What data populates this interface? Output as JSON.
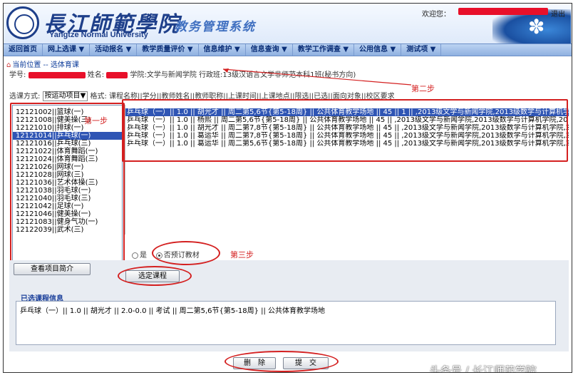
{
  "header": {
    "logo_cn": "長江師範學院",
    "logo_en": "Yangtze Normal University",
    "system_title": "教务管理系统",
    "welcome": "欢迎您：",
    "logout": "退出"
  },
  "nav": {
    "items": [
      {
        "label": "返回首页"
      },
      {
        "label": "网上选课 ▼"
      },
      {
        "label": "活动报名 ▼"
      },
      {
        "label": "教学质量评价 ▼"
      },
      {
        "label": "信息维护 ▼"
      },
      {
        "label": "信息查询 ▼"
      },
      {
        "label": "教学工作调查 ▼"
      },
      {
        "label": "公用信息 ▼"
      },
      {
        "label": "测试项 ▼"
      }
    ]
  },
  "breadcrumb": {
    "text": "当前位置 -- 选体育课"
  },
  "student_info": {
    "student_no_label": "学号:",
    "name_label": "姓名:",
    "college": "学院:文学与新闻学院",
    "class": "行政班:13级汉语言文学非师范本科1班(秘书方向)"
  },
  "selection": {
    "mode_label": "选课方式:",
    "mode_value": "按运动项目",
    "mode_arrow": "▼",
    "format_label": "格式:",
    "format_text": "课程名称||学分||教师姓名||教师职称||上课时间||上课地点||限选||已选||面向对象||校区要求"
  },
  "annotations": {
    "step1": "第一步",
    "step2": "第二步",
    "step3": "第三步"
  },
  "sports_list": [
    {
      "text": "12121002||篮球(一)"
    },
    {
      "text": "12121008||健美操(三)"
    },
    {
      "text": "12121010||排球(一)"
    },
    {
      "text": "12121014||乒乓球(一)"
    },
    {
      "text": "12121016||乒乓球(三)"
    },
    {
      "text": "12121022||体育舞蹈(一)"
    },
    {
      "text": "12121024||体育舞蹈(三)"
    },
    {
      "text": "12121026||网球(一)"
    },
    {
      "text": "12121028||网球(三)"
    },
    {
      "text": "12121036||艺术体操(三)"
    },
    {
      "text": "12121038||羽毛球(一)"
    },
    {
      "text": "12121040||羽毛球(三)"
    },
    {
      "text": "12121042||足球(一)"
    },
    {
      "text": "12121046||健美操(一)"
    },
    {
      "text": "12121083||健身气功(一)"
    },
    {
      "text": "12122039||武术(三)"
    }
  ],
  "course_list": [
    {
      "text": "乒乓球（一）|| 1.0 || 胡光才 || 周二第5,6节{第5-18周} || 公共体育教学场地 || 45 || 1 || ,2013级文学与新闻学院,2013级数学与计算机学院"
    },
    {
      "text": "乒乓球（一）|| 1.0 || 杨熙 || 周二第5,6节{第5-18周} || 公共体育教学场地 || 45 || ,2013级文学与新闻学院,2013级数学与计算机学院,20"
    },
    {
      "text": "乒乓球（一）|| 1.0 || 胡光才 || 周二第7,8节{第5-18周} || 公共体育教学场地 || 45 || ,2013级文学与新闻学院,2013级数学与计算机学院,2"
    },
    {
      "text": "乒乓球（一）|| 1.0 || 葛运华 || 周二第7,8节{第5-18周} || 公共体育教学场地 || 45 || ,2013级文学与新闻学院,2013级数学与计算机学院,2"
    },
    {
      "text": "乒乓球（一）|| 1.0 || 葛运华 || 周二第5,6节{第5-18周} || 公共体育教学场地 || 45 || ,2013级文学与新闻学院,2013级数学与计算机学院,2"
    }
  ],
  "textbook": {
    "yes_label": "是",
    "no_label": "否预订教材"
  },
  "buttons": {
    "view_intro": "查看项目简介",
    "select_course": "选定课程",
    "delete": "删　除",
    "submit": "提　交"
  },
  "chosen": {
    "title": "已选课程信息",
    "items": [
      {
        "text": "乒乓球（一）|| 1.0 || 胡光才 || 2.0-0.0 || 考试 || 周二第5,6节{第5-18周} || 公共体育教学场地"
      }
    ]
  },
  "watermark": "头条号 / 长江师范学院",
  "colors": {
    "accent_red": "#d42020",
    "selection_blue": "#2f55b4",
    "brand_blue": "#1e3f8a"
  }
}
